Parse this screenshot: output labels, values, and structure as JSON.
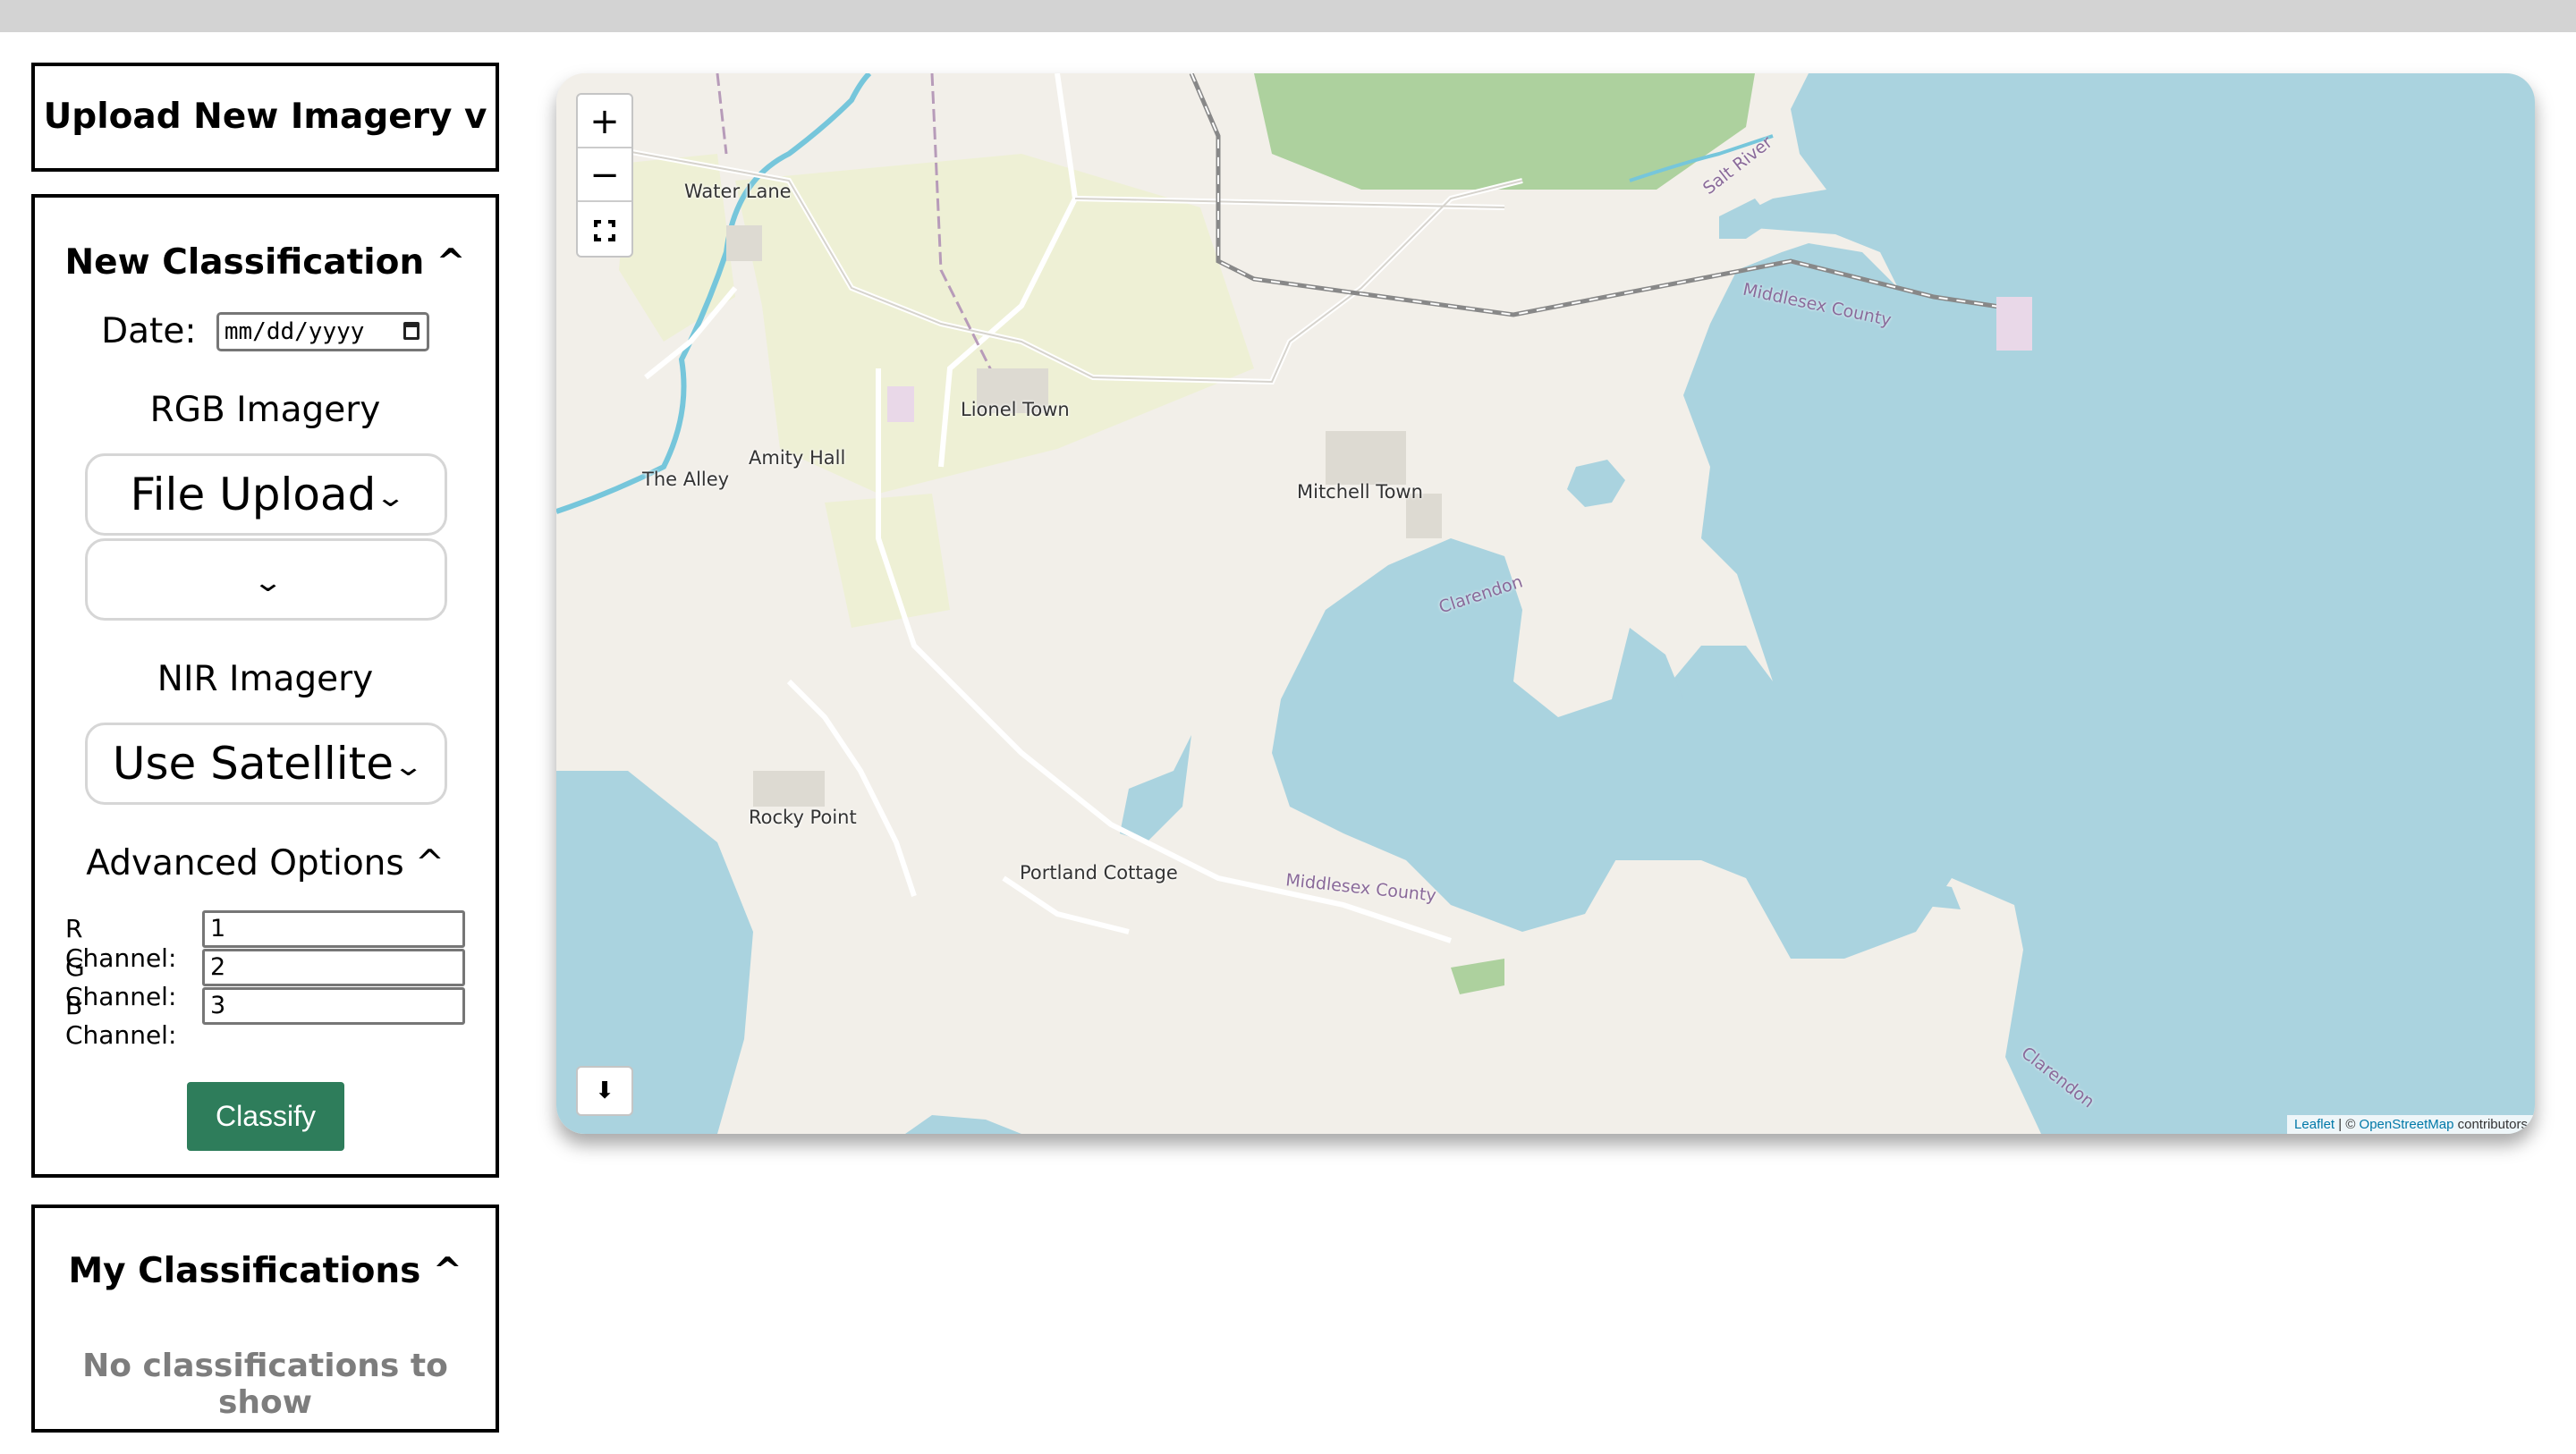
{
  "upload_panel": {
    "title": "Upload New Imagery v"
  },
  "classification_panel": {
    "title": "New Classification ^",
    "date_label": "Date:",
    "date_placeholder": "mm/dd/yyyy",
    "rgb_label": "RGB Imagery",
    "rgb_source": "File Upload",
    "rgb_file_value": "",
    "nir_label": "NIR Imagery",
    "nir_source": "Use Satellite",
    "advanced_label": "Advanced Options ^",
    "channels": [
      {
        "label": "R Channel:",
        "value": "1"
      },
      {
        "label": "G Channel:",
        "value": "2"
      },
      {
        "label": "B Channel:",
        "value": "3"
      }
    ],
    "classify_button": "Classify"
  },
  "my_classifications": {
    "title": "My Classifications ^",
    "empty_message": "No classifications to show"
  },
  "map": {
    "zoom_in": "+",
    "zoom_out": "−",
    "download_icon": "⬇",
    "attribution": {
      "leaflet": "Leaflet",
      "sep": " | © ",
      "osm": "OpenStreetMap",
      "suffix": " contributors"
    },
    "places": [
      "Water Lane",
      "Lionel Town",
      "Amity Hall",
      "The Alley",
      "Mitchell Town",
      "Rocky Point",
      "Portland Cottage"
    ],
    "admin_labels": [
      "Salt River",
      "Middlesex County",
      "Clarendon",
      "Middlesex County",
      "Clarendon"
    ],
    "colors": {
      "water": "#aad3df",
      "land": "#f2efe9",
      "forest": "#add19e",
      "farmland": "#eef0d5",
      "river": "#76c6db"
    }
  }
}
